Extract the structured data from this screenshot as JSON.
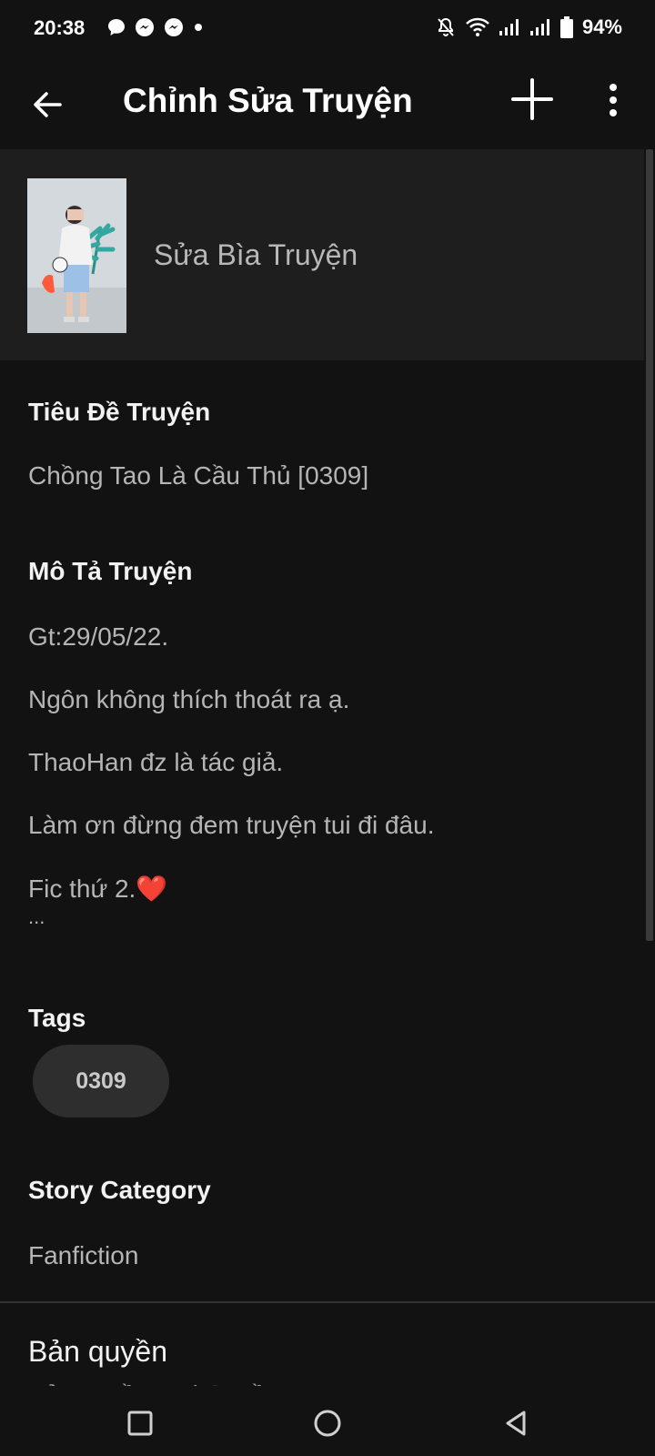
{
  "status_bar": {
    "time": "20:38",
    "battery": "94%",
    "left_icons": [
      "chat-bubble-icon",
      "messenger-icon",
      "messenger-icon",
      "dot-icon"
    ],
    "right_icons": [
      "mute-notification-icon",
      "wifi-icon",
      "signal-icon",
      "signal-icon",
      "battery-icon"
    ]
  },
  "app_bar": {
    "title": "Chỉnh Sửa Truyện"
  },
  "cover": {
    "label": "Sửa Bìa Truyện"
  },
  "title_section": {
    "heading": "Tiêu Đề Truyện",
    "value": "Chồng Tao Là Cầu Thủ [0309]"
  },
  "description_section": {
    "heading": "Mô Tả Truyện",
    "lines": [
      "Gt:29/05/22.",
      "Ngôn không thích thoát ra ạ.",
      "ThaoHan đz là tác giả.",
      "Làm ơn đừng đem truyện tui đi đâu.",
      "Fic thứ 2.❤️"
    ],
    "ellipsis": "..."
  },
  "tags_section": {
    "heading": "Tags",
    "tags": [
      "0309"
    ]
  },
  "category_section": {
    "heading": "Story Category",
    "value": "Fanfiction"
  },
  "copyright_section": {
    "heading": "Bản quyền",
    "value": "Bản quyền Mọi Quyền"
  },
  "colors": {
    "background": "#121212",
    "cover_row": "#1e1e1e",
    "chip": "#2e2e2e",
    "heart": "#d32f2f"
  }
}
